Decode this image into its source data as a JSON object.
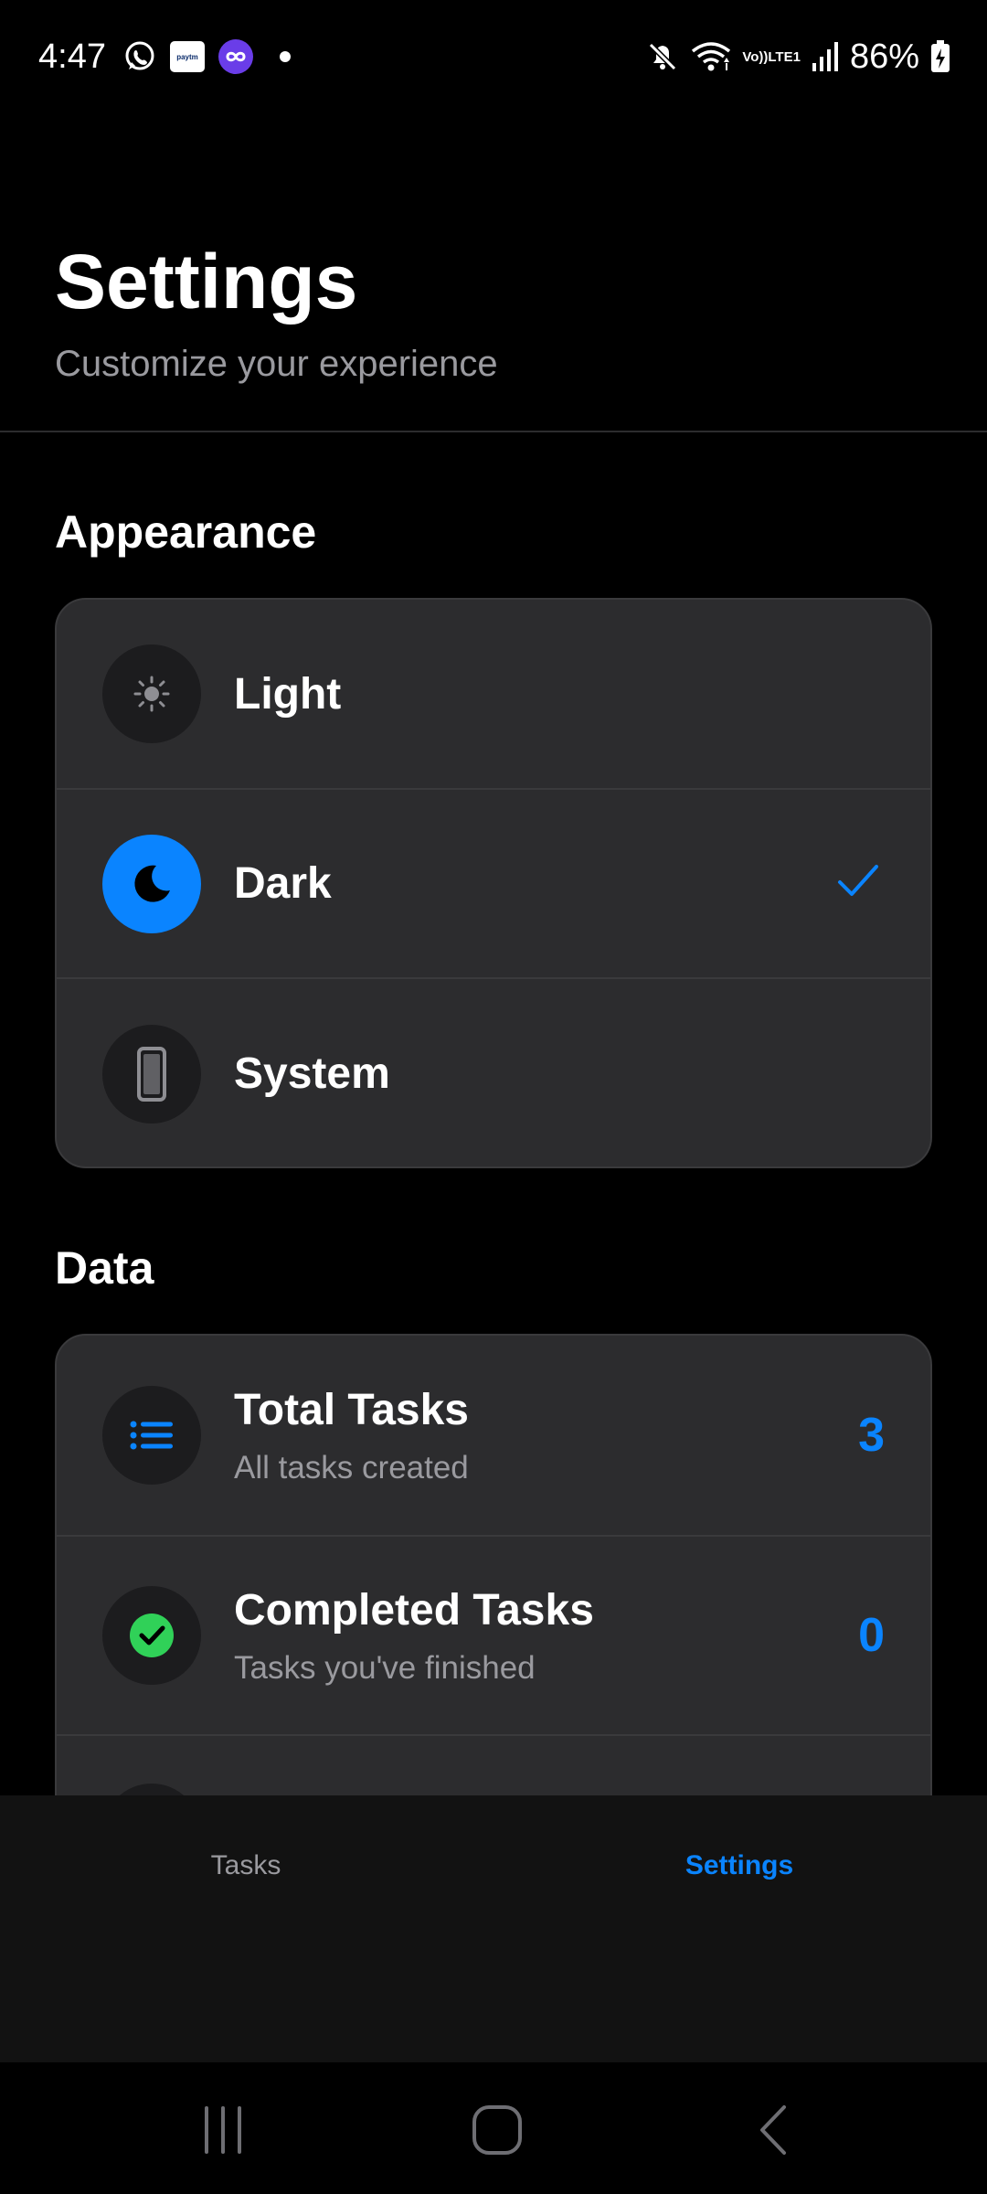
{
  "status_bar": {
    "time": "4:47",
    "battery": "86%",
    "network_label_top": "Vo))",
    "network_label_bottom": "LTE1",
    "paytm_label": "paytm",
    "icons": [
      "whatsapp-icon",
      "paytm-icon",
      "infinity-app-icon",
      "notification-dot",
      "mute-icon",
      "wifi-icon",
      "signal-icon",
      "battery-charging-icon"
    ]
  },
  "header": {
    "title": "Settings",
    "subtitle": "Customize your experience"
  },
  "appearance": {
    "section_title": "Appearance",
    "options": [
      {
        "label": "Light",
        "icon": "sun-icon",
        "selected": false
      },
      {
        "label": "Dark",
        "icon": "moon-icon",
        "selected": true
      },
      {
        "label": "System",
        "icon": "phone-icon",
        "selected": false
      }
    ]
  },
  "data_section": {
    "section_title": "Data",
    "items": [
      {
        "title": "Total Tasks",
        "subtitle": "All tasks created",
        "value": "3",
        "icon": "list-icon"
      },
      {
        "title": "Completed Tasks",
        "subtitle": "Tasks you've finished",
        "value": "0",
        "icon": "check-circle-icon"
      }
    ]
  },
  "tab_bar": {
    "tabs": [
      {
        "label": "Tasks",
        "active": false
      },
      {
        "label": "Settings",
        "active": true
      }
    ]
  },
  "colors": {
    "accent": "#0a84ff",
    "background": "#000000",
    "card": "#2c2c2e",
    "success": "#30d158",
    "secondary_text": "#9a9a9f"
  }
}
